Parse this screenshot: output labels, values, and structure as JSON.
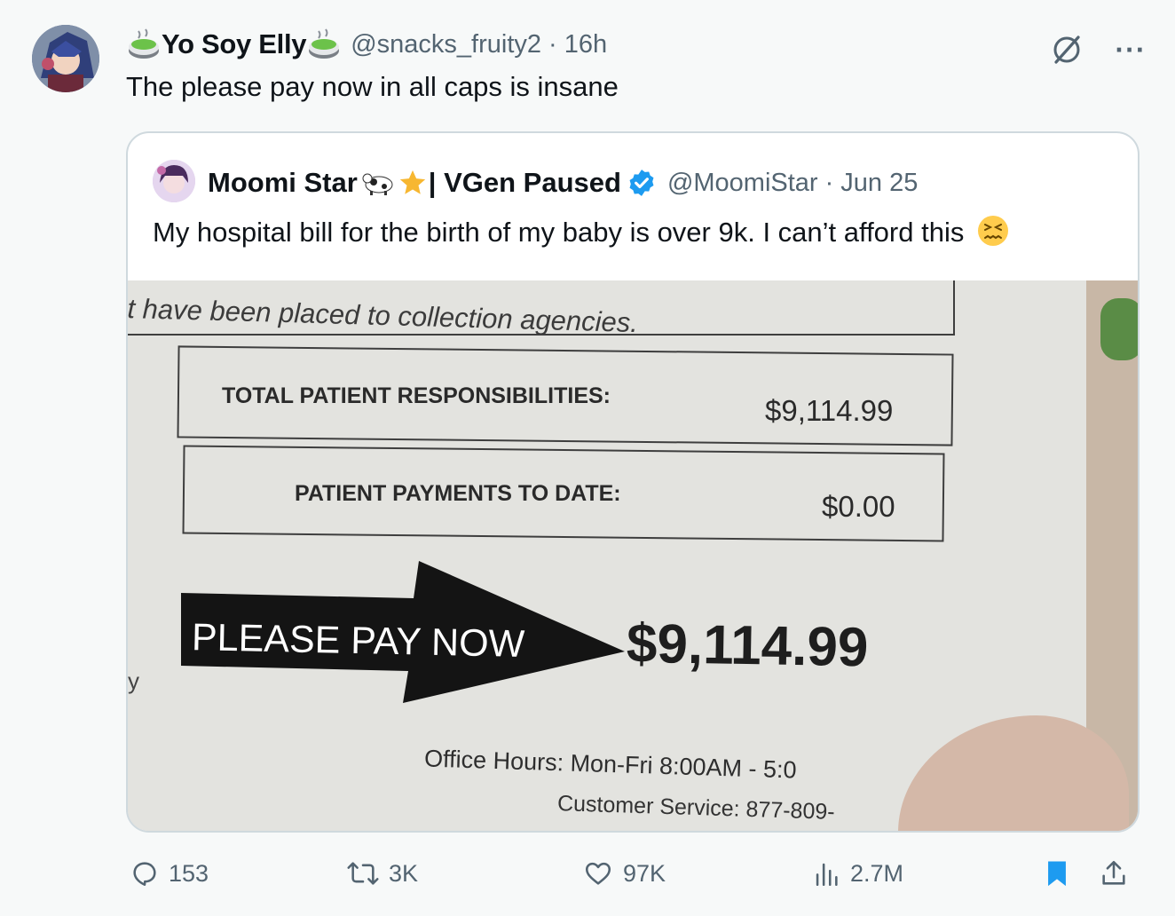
{
  "author": {
    "display_name": "Yo Soy Elly",
    "handle": "@snacks_fruity2",
    "time": "· 16h",
    "avatar_icon": "anime-character-avatar",
    "name_emoji": "tea-cup-emoji"
  },
  "tweet": {
    "text": "The please pay now in all caps is insane"
  },
  "top_icons": {
    "grok": "grok-icon",
    "more": "more-icon",
    "more_label": "···"
  },
  "quote": {
    "display_name": "Moomi Star",
    "name_suffix": "| VGen Paused",
    "handle": "@MoomiStar",
    "time": "· Jun 25",
    "text": "My hospital bill for the birth of my baby is over 9k. I can’t afford this",
    "verified_icon": "verified-badge-icon",
    "emoji": "confounded-face-emoji",
    "image": {
      "line1": "t have been placed to collection agencies.",
      "total_label": "TOTAL PATIENT RESPONSIBILITIES:",
      "total_value": "$9,114.99",
      "payments_label": "PATIENT PAYMENTS TO DATE:",
      "payments_value": "$0.00",
      "please_label": "PLEASE PAY NOW",
      "please_value": "$9,114.99",
      "office_hours": "Office Hours: Mon-Fri 8:00AM - 5:0",
      "customer_service": "Customer Service: 877-809-",
      "edge_char": "y"
    }
  },
  "actions": {
    "replies": "153",
    "reposts": "3K",
    "likes": "97K",
    "views": "2.7M"
  },
  "colors": {
    "background": "#f7f9f9",
    "muted": "#536471",
    "verified": "#1d9bf0",
    "bookmark": "#1d9bf0",
    "border": "#cfd9de"
  }
}
